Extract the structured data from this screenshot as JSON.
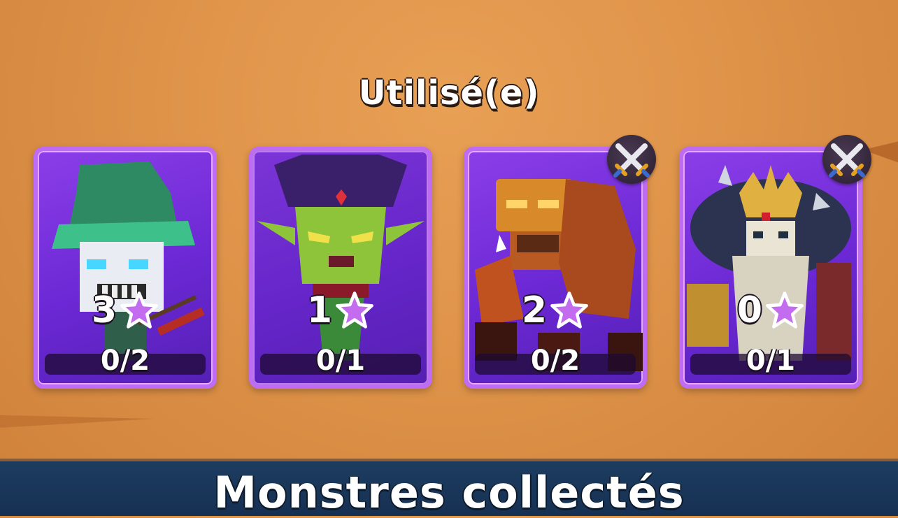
{
  "section": {
    "title": "Utilisé(e)"
  },
  "cards": [
    {
      "name": "monster-card-skeleton-wizard",
      "stars": "3",
      "progress": "0/2",
      "progress_value": 0,
      "progress_max": 2,
      "crossed_swords_badge": false
    },
    {
      "name": "monster-card-goblin-mage",
      "stars": "1",
      "progress": "0/1",
      "progress_value": 0,
      "progress_max": 1,
      "crossed_swords_badge": false
    },
    {
      "name": "monster-card-rock-golem",
      "stars": "2",
      "progress": "0/2",
      "progress_value": 0,
      "progress_max": 2,
      "crossed_swords_badge": true
    },
    {
      "name": "monster-card-skeleton-king",
      "stars": "0",
      "progress": "0/1",
      "progress_value": 0,
      "progress_max": 1,
      "crossed_swords_badge": true
    }
  ],
  "footer": {
    "title": "Monstres collectés"
  },
  "colors": {
    "card_border": "#bf6cf5",
    "card_bg": "#6b28d4",
    "star": "#c46cf0",
    "footer_bg": "#1d3d60",
    "background": "#de9349"
  },
  "icons": {
    "star": "star-icon",
    "badge": "crossed-swords-icon"
  }
}
